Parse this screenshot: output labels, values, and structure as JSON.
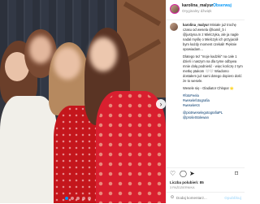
{
  "header": {
    "username": "karolina_malyur",
    "separator": "•",
    "follow_label": "Obserwuj",
    "subtitle": "Oryginalny dźwięk"
  },
  "caption": {
    "username": "karolina_malyur",
    "paragraphs": [
      "Miniałe już trochę czasu od wesela @kamil_b i @justyna.m z Mielczyka, ale ja nagle nadal myślę o Mielczyk ich przyjaciół bym każdy moment czekali! Pięknie opowiadam...",
      "Dlatego też \"moje kadziki\" na całe 1 dzień i naszym na dla tyme odbywa mnie dołą podnieść - więc kończę z tym metkę ptakom 🤍🤍 Wiadomo dostałem już sami dotego dopiero dość że to wesele.",
      "Wesele się - Gladiator Chłopa! 🌟"
    ],
    "hashtags": [
      "#fotoFeela",
      "#weselefotografia",
      "#weseleKS"
    ],
    "mentions": [
      "@piotrweselegotografiaPL",
      "@prośeStolewan"
    ]
  },
  "actions": {
    "like_icon": "heart-icon",
    "comment_icon": "comment-icon",
    "share_icon": "share-icon",
    "save_icon": "bookmark-icon"
  },
  "stats": {
    "likes_text": "Liczba polubień: 85",
    "date": "3 PAŹDZIERNIKA"
  },
  "comment": {
    "placeholder": "Dodaj komentarz...",
    "publish_label": "Opublikuj"
  },
  "photo": {
    "carousel_count": 5,
    "carousel_active": 1
  },
  "colors": {
    "link": "#0095f6",
    "hashtag": "#00376b",
    "dress_red": "#d91f2f"
  }
}
